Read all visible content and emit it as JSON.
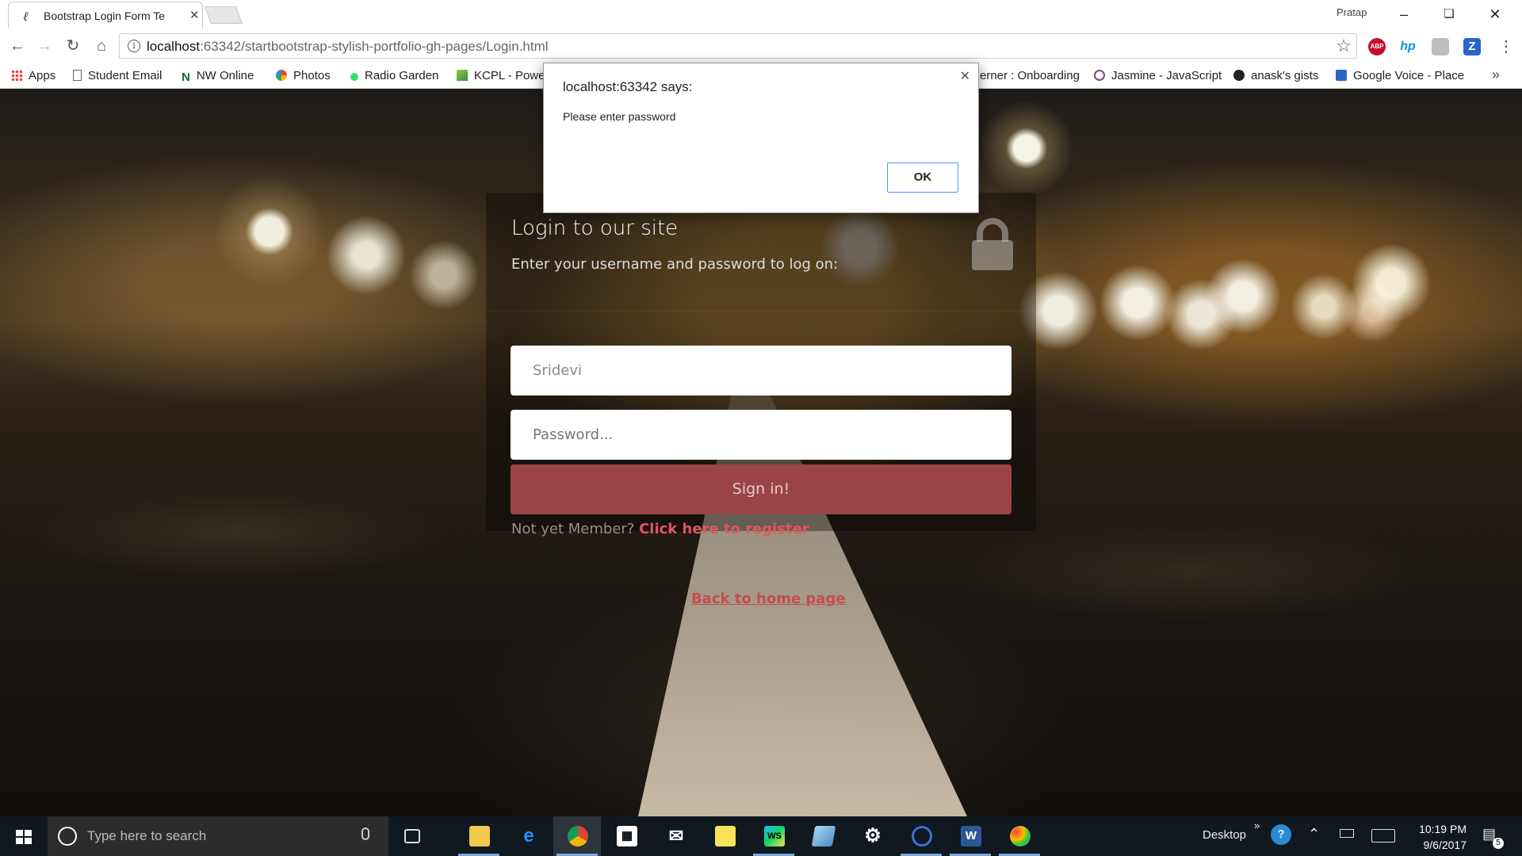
{
  "browser": {
    "tab_title": "Bootstrap Login Form Te",
    "profile_name": "Pratap",
    "url_host": "localhost",
    "url_path": ":63342/startbootstrap-stylish-portfolio-gh-pages/Login.html"
  },
  "bookmarks": [
    {
      "label": "Apps"
    },
    {
      "label": "Student Email"
    },
    {
      "label": "NW Online"
    },
    {
      "label": "Photos"
    },
    {
      "label": "Radio Garden"
    },
    {
      "label": "KCPL - Powe"
    },
    {
      "label": "erner : Onboarding"
    },
    {
      "label": "Jasmine - JavaScript"
    },
    {
      "label": "anask's gists"
    },
    {
      "label": "Google Voice - Place"
    }
  ],
  "extensions": [
    {
      "label": "ABP",
      "color": "#c70d2c"
    },
    {
      "label": "hp",
      "color": "#0096d6"
    },
    {
      "label": "",
      "color": "#bdbdbd"
    },
    {
      "label": "Z",
      "color": "#2a64c5"
    }
  ],
  "alert": {
    "title": "localhost:63342 says:",
    "message": "Please enter password",
    "ok_label": "OK"
  },
  "login": {
    "title": "Login to our site",
    "subtitle": "Enter your username and password to log on:",
    "username_value": "Sridevi",
    "password_placeholder": "Password...",
    "signin_label": "Sign in!",
    "register_prompt": "Not yet Member? ",
    "register_link": "Click here to register",
    "back_link": "Back to home page",
    "button_color": "#9b4446"
  },
  "taskbar": {
    "search_placeholder": "Type here to search",
    "desktop_label": "Desktop",
    "time": "10:19 PM",
    "date": "9/6/2017",
    "notification_count": "5",
    "apps": [
      {
        "name": "file-explorer-icon"
      },
      {
        "name": "edge-icon"
      },
      {
        "name": "chrome-icon"
      },
      {
        "name": "store-icon"
      },
      {
        "name": "mail-icon"
      },
      {
        "name": "sticky-notes-icon"
      },
      {
        "name": "webstorm-icon"
      },
      {
        "name": "app-icon"
      },
      {
        "name": "settings-icon"
      },
      {
        "name": "app-icon"
      },
      {
        "name": "word-icon"
      },
      {
        "name": "paint-icon"
      }
    ]
  }
}
